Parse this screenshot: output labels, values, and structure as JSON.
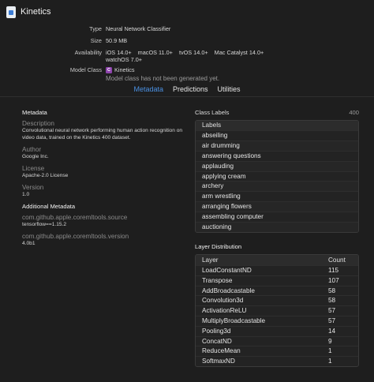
{
  "header": {
    "title": "Kinetics",
    "icon": "mlmodel-file-icon"
  },
  "info": {
    "type_label": "Type",
    "type_value": "Neural Network Classifier",
    "size_label": "Size",
    "size_value": "50.9 MB",
    "availability_label": "Availability",
    "availability": [
      "iOS 14.0+",
      "macOS 11.0+",
      "tvOS 14.0+",
      "Mac Catalyst 14.0+",
      "watchOS 7.0+"
    ],
    "model_class_label": "Model Class",
    "model_class_badge": "C",
    "model_class_value": "Kinetics",
    "model_class_note": "Model class has not been generated yet."
  },
  "tabs": [
    {
      "label": "Metadata",
      "active": true
    },
    {
      "label": "Predictions",
      "active": false
    },
    {
      "label": "Utilities",
      "active": false
    }
  ],
  "metadata": {
    "title": "Metadata",
    "description_label": "Description",
    "description": "Convolutional neural network performing human action recognition on video data, trained on the Kinetics 400 dataset.",
    "author_label": "Author",
    "author": "Google Inc.",
    "license_label": "License",
    "license": "Apache-2.0 License",
    "version_label": "Version",
    "version": "1.0",
    "additional_title": "Additional Metadata",
    "source_key": "com.github.apple.coremltools.source",
    "source_value": "tensorflow==1.15.2",
    "tools_version_key": "com.github.apple.coremltools.version",
    "tools_version_value": "4.0b1"
  },
  "class_labels": {
    "title": "Class Labels",
    "count": "400",
    "column": "Labels",
    "items": [
      "abseiling",
      "air drumming",
      "answering questions",
      "applauding",
      "applying cream",
      "archery",
      "arm wrestling",
      "arranging flowers",
      "assembling computer",
      "auctioning"
    ]
  },
  "layer_distribution": {
    "title": "Layer Distribution",
    "col_layer": "Layer",
    "col_count": "Count",
    "rows": [
      {
        "layer": "LoadConstantND",
        "count": "115"
      },
      {
        "layer": "Transpose",
        "count": "107"
      },
      {
        "layer": "AddBroadcastable",
        "count": "58"
      },
      {
        "layer": "Convolution3d",
        "count": "58"
      },
      {
        "layer": "ActivationReLU",
        "count": "57"
      },
      {
        "layer": "MultiplyBroadcastable",
        "count": "57"
      },
      {
        "layer": "Pooling3d",
        "count": "14"
      },
      {
        "layer": "ConcatND",
        "count": "9"
      },
      {
        "layer": "ReduceMean",
        "count": "1"
      },
      {
        "layer": "SoftmaxND",
        "count": "1"
      }
    ]
  },
  "colors": {
    "accent": "#4a90e2",
    "background": "#1e1e1e",
    "badge": "#8e44ad"
  }
}
